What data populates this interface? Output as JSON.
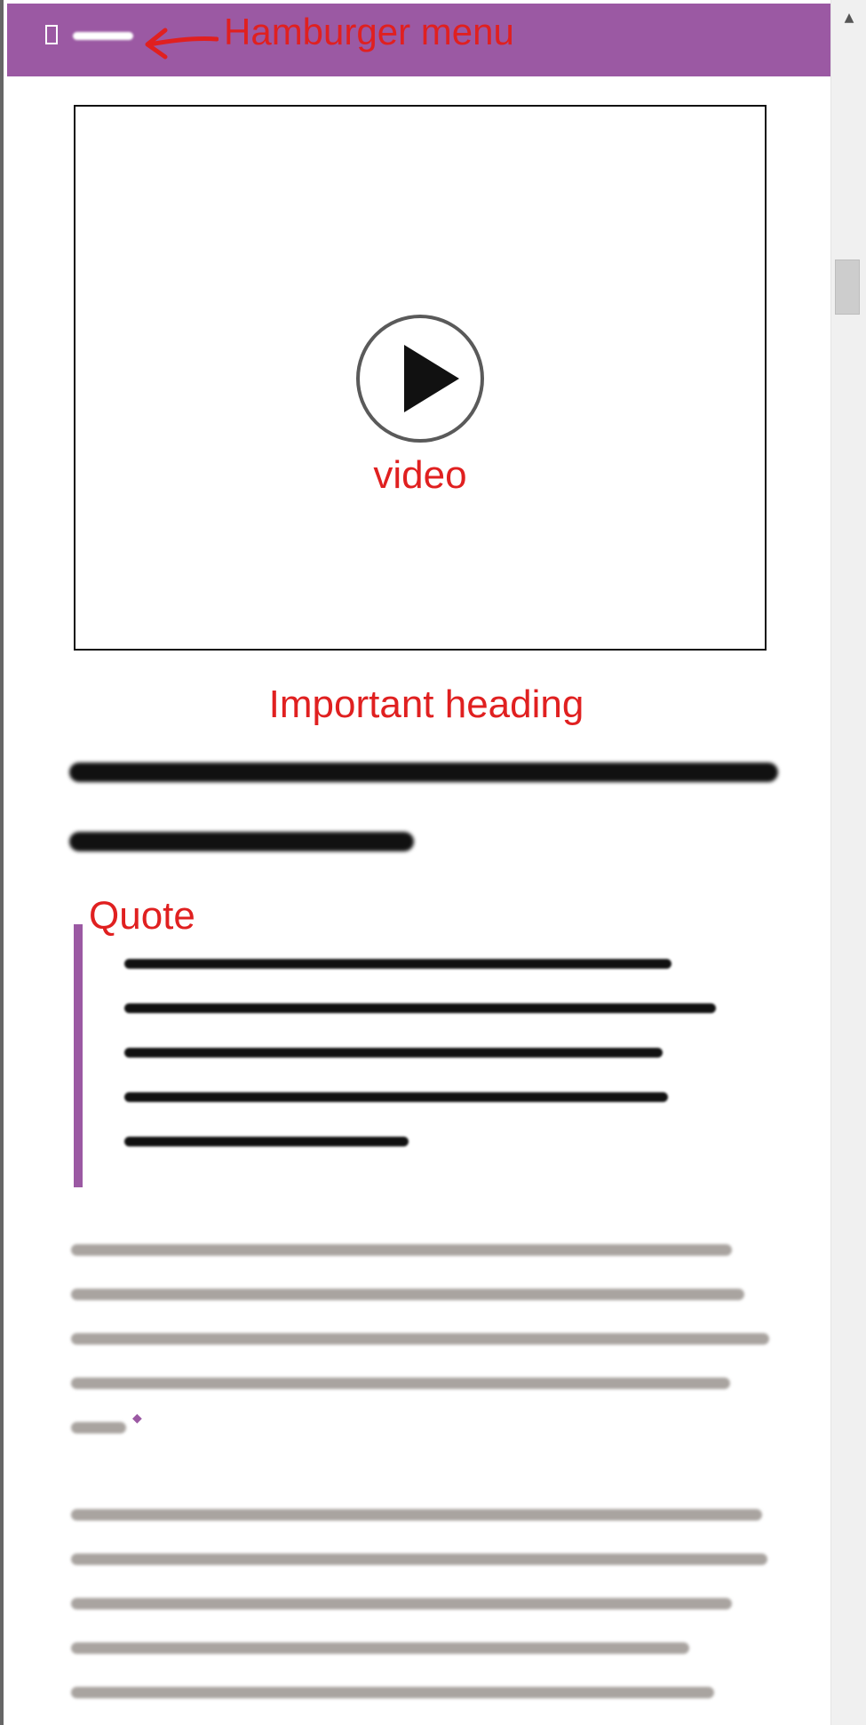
{
  "header": {
    "menu_icon": "menu-icon",
    "background_color": "#9b59a3"
  },
  "annotations": {
    "hamburger_menu": "Hamburger menu",
    "video": "video",
    "important_heading": "Important heading",
    "quote": "Quote"
  },
  "video": {
    "play_icon": "play-icon"
  },
  "colors": {
    "accent": "#9b59a3",
    "annotation": "#e02020",
    "body_text": "#a9a4a0",
    "heading_text": "#111111"
  }
}
